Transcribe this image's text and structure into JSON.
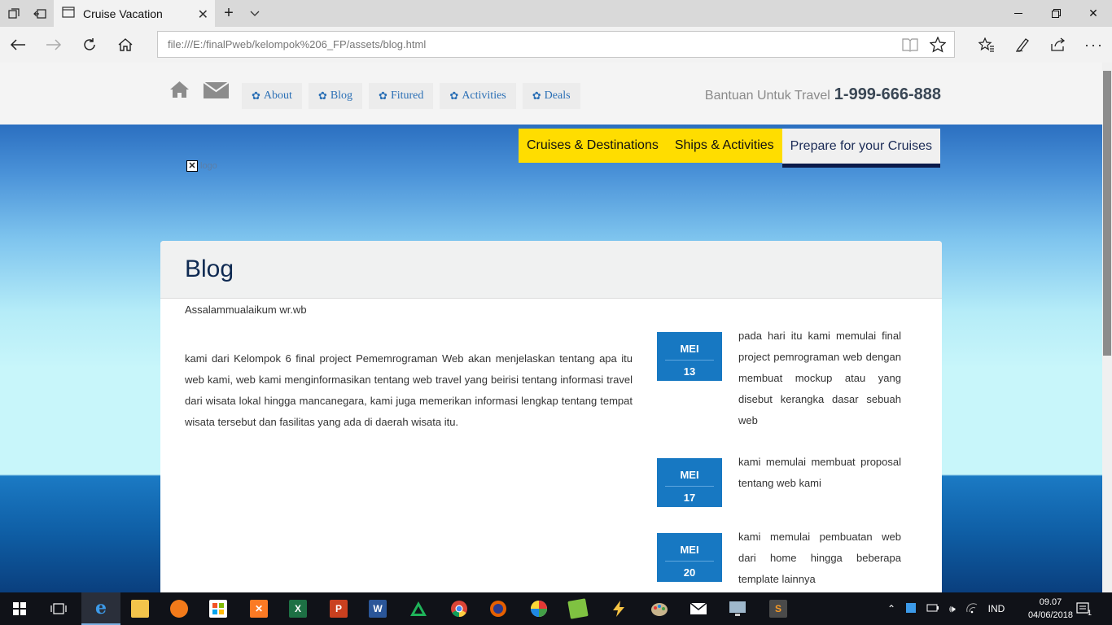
{
  "browser": {
    "tab_title": "Cruise Vacation",
    "url": "file:///E:/finalPweb/kelompok%206_FP/assets/blog.html"
  },
  "header": {
    "menu": [
      {
        "label": "About"
      },
      {
        "label": "Blog"
      },
      {
        "label": "Fitured"
      },
      {
        "label": "Activities"
      },
      {
        "label": "Deals"
      }
    ],
    "help_label": "Bantuan Untuk Travel",
    "help_phone": "1-999-666-888"
  },
  "main_menu": [
    {
      "label": "Cruises & Destinations"
    },
    {
      "label": "Ships & Activities"
    },
    {
      "label": "Prepare for your Cruises"
    }
  ],
  "logo": {
    "alt": "logo"
  },
  "blog": {
    "title": "Blog",
    "greeting": "Assalammualaikum wr.wb",
    "intro": "kami dari Kelompok 6 final project Pememrograman Web akan menjelaskan tentang apa itu web kami, web kami menginformasikan tentang web travel yang beirisi tentang informasi travel dari wisata lokal hingga mancanegara, kami juga memerikan informasi lengkap tentang tempat wisata tersebut dan fasilitas yang ada di daerah wisata itu.",
    "events": [
      {
        "month": "MEI",
        "day": "13",
        "text": "pada hari itu kami memulai final project pemrograman web dengan membuat mockup atau yang disebut kerangka dasar sebuah web"
      },
      {
        "month": "MEI",
        "day": "17",
        "text": "kami memulai membuat proposal tentang web kami"
      },
      {
        "month": "MEI",
        "day": "20",
        "text": "kami memulai pembuatan web dari home hingga beberapa template lainnya"
      }
    ]
  },
  "taskbar": {
    "language": "IND",
    "time": "09.07",
    "date": "04/06/2018",
    "notification_count": "1"
  },
  "colors": {
    "accent_yellow": "#ffdd00",
    "date_badge": "#1778c2",
    "heading_navy": "#0f2a52",
    "link_blue": "#2a6fb5"
  }
}
